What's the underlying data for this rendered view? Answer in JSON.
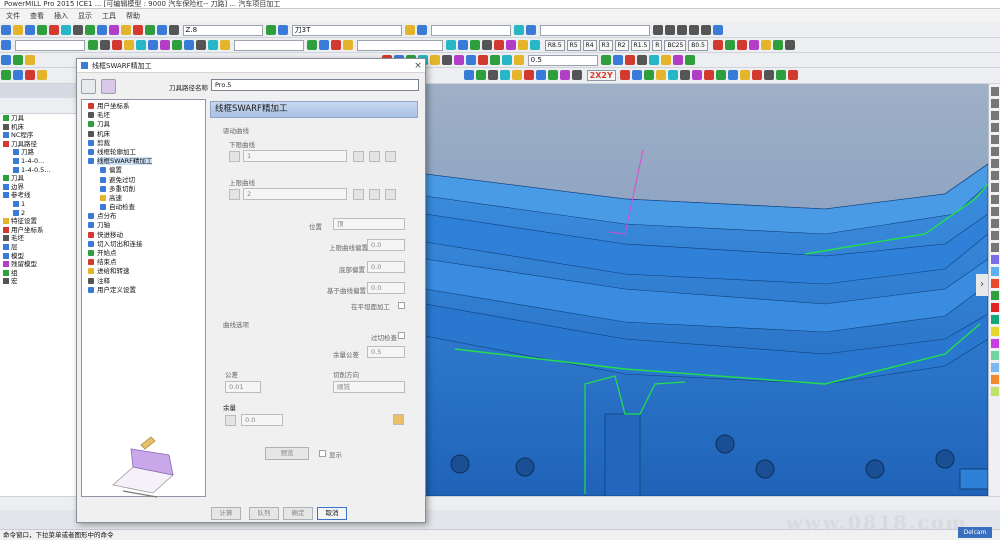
{
  "window": {
    "title": "PowerMILL Pro 2015 ICE1 ... [可编辑模型 : 9000 汽车保险杠-- 刀路]  ... 汽车项目加工"
  },
  "menu": [
    "文件",
    "查看",
    "插入",
    "显示",
    "工具",
    "帮助"
  ],
  "toolbar": {
    "tool_combo": "Z.8",
    "name_combo": "刀3T",
    "buttons_row2": [
      "R8.5",
      "R5",
      "R4",
      "R3",
      "R2",
      "R1.5",
      "R",
      "BC25",
      "B0.5"
    ],
    "buttons_row3": [
      "2X2Y"
    ],
    "value_combo": "0.5"
  },
  "explorer": {
    "items": [
      {
        "label": "刀具",
        "color": "#2f9e3c"
      },
      {
        "label": "机床",
        "color": "#555555"
      },
      {
        "label": "NC程序",
        "color": "#3b7bd8"
      },
      {
        "label": "刀具路径",
        "color": "#d23a2f"
      },
      {
        "label": "刀路",
        "color": "#3b7bd8"
      },
      {
        "label": "1-4-0...",
        "color": "#3b7bd8"
      },
      {
        "label": "1-4-0.5...",
        "color": "#3b7bd8"
      },
      {
        "label": "刀具",
        "color": "#2f9e3c"
      },
      {
        "label": "边界",
        "color": "#3b7bd8"
      },
      {
        "label": "参考线",
        "color": "#3b7bd8"
      },
      {
        "label": "1",
        "color": "#3b7bd8"
      },
      {
        "label": "2",
        "color": "#3b7bd8"
      },
      {
        "label": "特征设置",
        "color": "#e4b52b"
      },
      {
        "label": "用户坐标系",
        "color": "#d23a2f"
      },
      {
        "label": "毛坯",
        "color": "#555555"
      },
      {
        "label": "层",
        "color": "#3b7bd8"
      },
      {
        "label": "模型",
        "color": "#3b7bd8"
      },
      {
        "label": "残留模型",
        "color": "#b23ec8"
      },
      {
        "label": "组",
        "color": "#2f9e3c"
      },
      {
        "label": "宏",
        "color": "#555555"
      }
    ]
  },
  "dialog": {
    "title": "线框SWARF精加工",
    "name_label": "刀具路径名称",
    "name_value": "Pro.5",
    "header": "线框SWARF精加工",
    "tree": [
      {
        "label": "用户坐标系",
        "color": "#d23a2f"
      },
      {
        "label": "毛坯",
        "color": "#555555"
      },
      {
        "label": "刀具",
        "color": "#2f9e3c"
      },
      {
        "label": "机床",
        "color": "#555555"
      },
      {
        "label": "剪裁",
        "color": "#3b7bd8"
      },
      {
        "label": "线框轮廓加工",
        "color": "#3b7bd8"
      },
      {
        "label": "线框SWARF精加工",
        "color": "#3b7bd8",
        "selected": true
      },
      {
        "label": "偏置",
        "color": "#3b7bd8"
      },
      {
        "label": "避免过切",
        "color": "#3b7bd8"
      },
      {
        "label": "多重切削",
        "color": "#3b7bd8"
      },
      {
        "label": "高速",
        "color": "#e4b52b"
      },
      {
        "label": "自动检查",
        "color": "#3b7bd8"
      },
      {
        "label": "点分布",
        "color": "#3b7bd8"
      },
      {
        "label": "刀轴",
        "color": "#3b7bd8"
      },
      {
        "label": "快进移动",
        "color": "#d23a2f"
      },
      {
        "label": "切入切出和连接",
        "color": "#3b7bd8"
      },
      {
        "label": "开始点",
        "color": "#2f9e3c"
      },
      {
        "label": "结束点",
        "color": "#d23a2f"
      },
      {
        "label": "进给和转速",
        "color": "#e4b52b"
      },
      {
        "label": "注释",
        "color": "#555555"
      },
      {
        "label": "用户定义设置",
        "color": "#3b7bd8"
      }
    ],
    "group_top": "驱动曲线",
    "lower_label": "下限曲线",
    "lower_value": "1",
    "upper_label": "上限曲线",
    "upper_value": "2",
    "position_label": "位置",
    "position_value": "顶",
    "offset1_label": "上限曲线偏置",
    "offset1_value": "0.0",
    "offset2_label": "底部偏置",
    "offset2_value": "0.0",
    "offset3_label": "基于曲线偏置",
    "offset3_value": "0.0",
    "check_label": "在平坦面加工",
    "group2_title": "曲线选项",
    "check2_label": "过切检查",
    "tolerance_label": "余量公差",
    "tolerance_value": "0.5",
    "tol_label": "公差",
    "tol_value": "0.01",
    "cut_dir_label": "切削方向",
    "cut_dir_value": "顺铣",
    "stock_label": "余量",
    "stock_value": "0.0",
    "preview_btn": "预览",
    "preview_chk": "显示",
    "calc_btn": "计算",
    "queue_btn": "队列",
    "cancel_btn": "确定",
    "accept_btn": "取消"
  },
  "viewport": {
    "background": "#8aa1c2",
    "part_color": "#2e7ed6"
  },
  "status": {
    "text": "命令窗口，下拉菜单或者图形中的命令",
    "watermark": "www.0818.com",
    "badge": "Delcam"
  }
}
